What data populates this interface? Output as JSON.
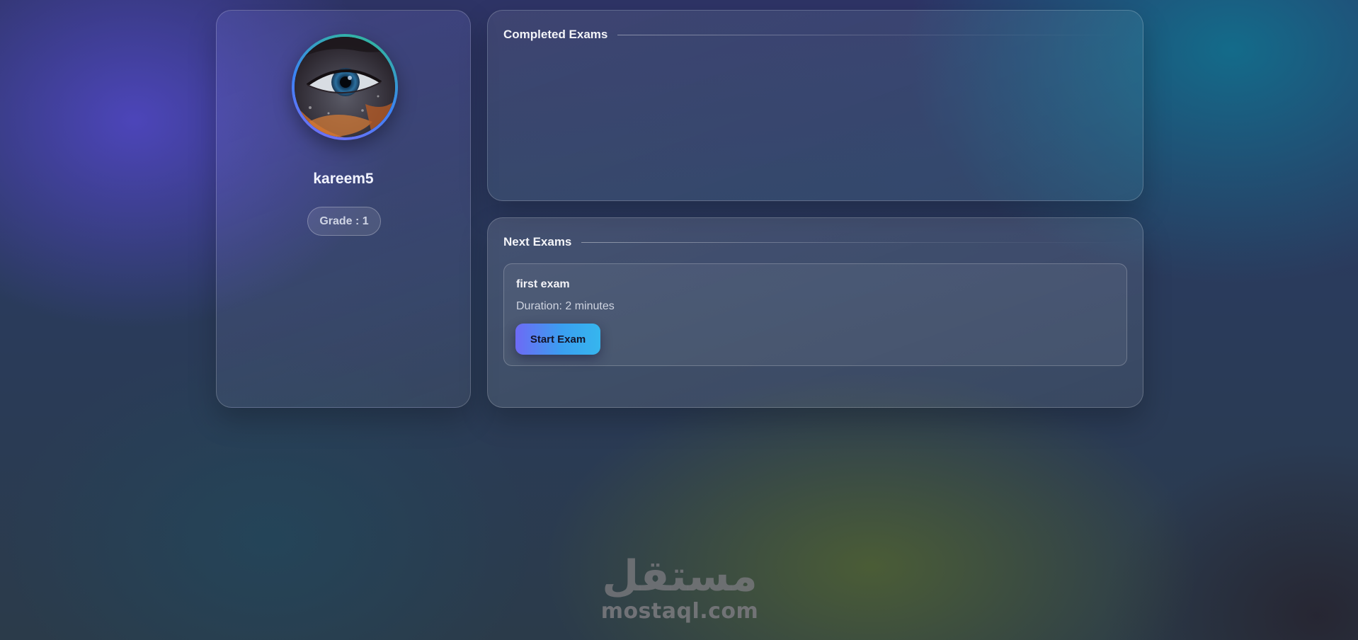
{
  "profile": {
    "username": "kareem5",
    "grade_label": "Grade : 1",
    "avatar_alt": "profile-eye-photo"
  },
  "completed_exams": {
    "title": "Completed Exams",
    "items": []
  },
  "next_exams": {
    "title": "Next Exams",
    "items": [
      {
        "title": "first exam",
        "duration": "Duration: 2 minutes",
        "button_label": "Start Exam"
      }
    ]
  },
  "watermark": {
    "logo_text": "مستقل",
    "site": "mostaql.com"
  },
  "colors": {
    "button_gradient_start": "#6d6af5",
    "button_gradient_end": "#36b6ee",
    "avatar_ring_start": "#2fbf8f",
    "avatar_ring_end": "#7b6cf6",
    "watermark": "#78787c"
  }
}
